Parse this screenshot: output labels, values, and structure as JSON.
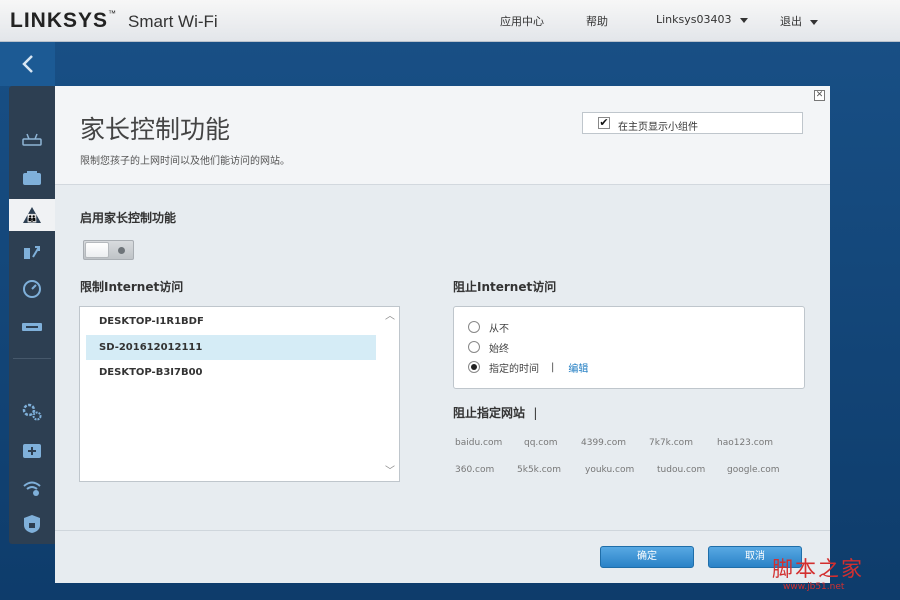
{
  "header": {
    "logo": "LINKSYS",
    "logo_tm": "™",
    "product": "Smart Wi-Fi",
    "nav": {
      "app_center": "应用中心",
      "help": "帮助",
      "account": "Linksys03403",
      "logout": "退出"
    }
  },
  "sidebar": {
    "icons": [
      "back-arrow-icon",
      "router-icon",
      "devices-icon",
      "parental-controls-icon",
      "priority-icon",
      "speed-test-icon",
      "usb-icon",
      "settings-icon",
      "troubleshoot-icon",
      "wifi-icon",
      "security-icon"
    ],
    "active": "parental-controls-icon"
  },
  "modal": {
    "title": "家长控制功能",
    "subtitle": "限制您孩子的上网时间以及他们能访问的网站。",
    "widget_checkbox": {
      "label": "在主页显示小组件",
      "checked": true
    },
    "enable_label": "启用家长控制功能",
    "enable_toggle": {
      "on": false
    },
    "restrict_label": "限制Internet访问",
    "devices": [
      "DESKTOP-I1R1BDF",
      "SD-201612012111",
      "DESKTOP-B3I7B00"
    ],
    "selected_device": "SD-201612012111",
    "block_label": "阻止Internet访问",
    "block_options": [
      "从不",
      "始终",
      "指定的时间"
    ],
    "block_selected": "指定的时间",
    "separator": "|",
    "edit_link": "编辑",
    "block_sites_label": "阻止指定网站",
    "block_sites_separator": "|",
    "sites": [
      "baidu.com",
      "qq.com",
      "4399.com",
      "7k7k.com",
      "hao123.com",
      "360.com",
      "5k5k.com",
      "youku.com",
      "tudou.com",
      "google.com"
    ],
    "ok_button": "确定",
    "cancel_button": "取消"
  },
  "watermark": {
    "text": "脚本之家",
    "url": "www.jb51.net"
  }
}
